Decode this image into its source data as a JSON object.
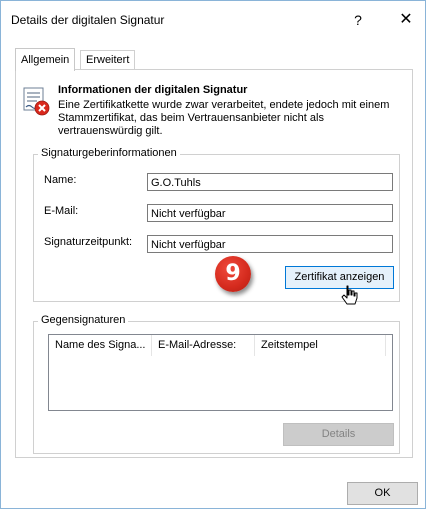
{
  "window": {
    "title": "Details der digitalen Signatur",
    "help_glyph": "?",
    "close_glyph": "✕"
  },
  "tabs": [
    {
      "label": "Allgemein",
      "active": true
    },
    {
      "label": "Erweitert",
      "active": false
    }
  ],
  "info": {
    "icon": "certificate-error-icon",
    "heading": "Informationen der digitalen Signatur",
    "text": "Eine Zertifikatkette wurde zwar verarbeitet, endete jedoch mit einem Stammzertifikat, das beim Vertrauensanbieter nicht als vertrauenswürdig gilt."
  },
  "signer": {
    "group_label": "Signaturgeberinformationen",
    "name_label": "Name:",
    "name_value": "G.O.Tuhls",
    "email_label": "E-Mail:",
    "email_value": "Nicht verfügbar",
    "time_label": "Signaturzeitpunkt:",
    "time_value": "Nicht verfügbar",
    "view_cert_button": "Zertifikat anzeigen"
  },
  "annotation": {
    "step_number": "9",
    "color": "#d42a1d"
  },
  "countersignatures": {
    "group_label": "Gegensignaturen",
    "columns": [
      "Name des Signa...",
      "E-Mail-Adresse:",
      "Zeitstempel"
    ],
    "details_button": "Details"
  },
  "footer": {
    "ok_button": "OK"
  }
}
